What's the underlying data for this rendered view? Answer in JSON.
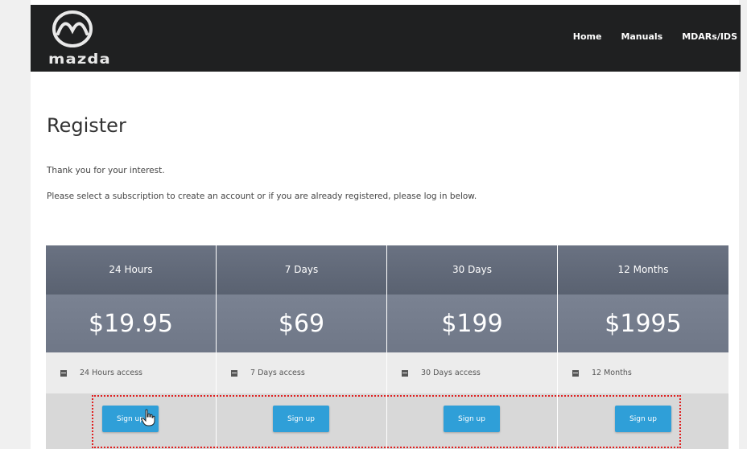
{
  "header": {
    "logo_text": "mazda",
    "nav": [
      "Home",
      "Manuals",
      "MDARs/IDS"
    ]
  },
  "main": {
    "title": "Register",
    "intro": "Thank you for your interest.",
    "instructions": "Please select a subscription to create an account or if you are already registered, please log in below."
  },
  "plans": [
    {
      "name": "24 Hours",
      "price": "$19.95",
      "feature": "24 Hours access",
      "button": "Sign up"
    },
    {
      "name": "7 Days",
      "price": "$69",
      "feature": "7 Days access",
      "button": "Sign up"
    },
    {
      "name": "30 Days",
      "price": "$199",
      "feature": "30 Days access",
      "button": "Sign up"
    },
    {
      "name": "12 Months",
      "price": "$1995",
      "feature": "12 Months",
      "button": "Sign up"
    }
  ],
  "colors": {
    "header_bg": "#1f2021",
    "plan_header": "#5a6271",
    "button": "#2f9fd8",
    "highlight": "#e02020"
  },
  "icons": [
    "mazda-logo-icon",
    "calendar-icon",
    "hand-pointer-icon"
  ]
}
